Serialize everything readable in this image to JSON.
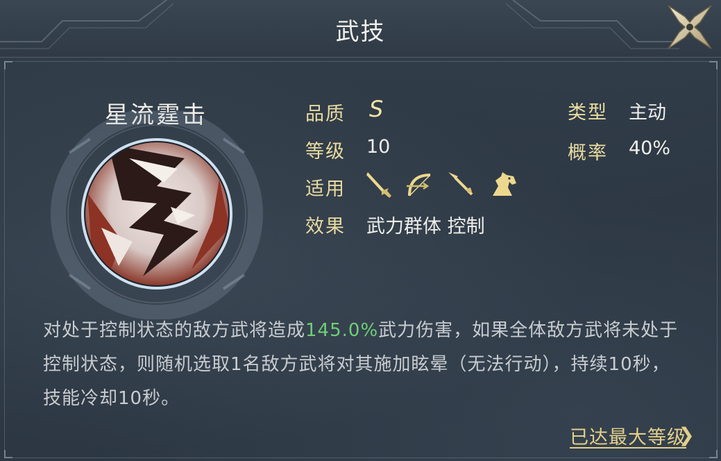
{
  "header": {
    "title": "武技"
  },
  "skill": {
    "name": "星流霆击",
    "quality_label": "品质",
    "quality_value": "S",
    "level_label": "等级",
    "level_value": "10",
    "applies_label": "适用",
    "applies_icons": [
      "sword-icon",
      "bow-icon",
      "spear-icon",
      "horse-icon"
    ],
    "effect_label": "效果",
    "effect_value": "武力群体 控制",
    "type_label": "类型",
    "type_value": "主动",
    "chance_label": "概率",
    "chance_value": "40%"
  },
  "description": {
    "part1": "对处于控制状态的敌方武将造成",
    "highlight": "145.0%",
    "part2": "武力伤害，如果全体敌方武将未处于控制状态，则随机选取1名敌方武将对其施加眩晕（无法行动），持续10秒，技能冷却10秒。"
  },
  "footer": {
    "max_level_label": "已达最大等级",
    "chevron": "❯"
  },
  "colors": {
    "label_gold": "#e9dba0",
    "highlight_green": "#6fcf76",
    "link_gold": "#e3cf8a"
  }
}
